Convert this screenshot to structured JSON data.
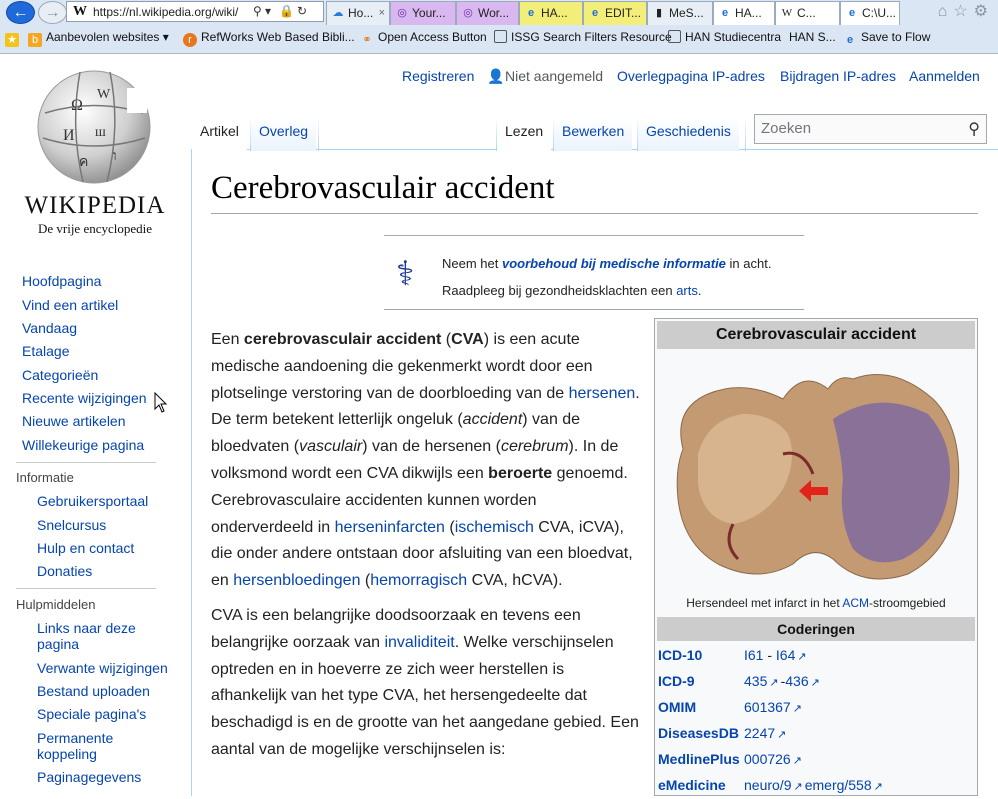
{
  "browser": {
    "url": "https://nl.wikipedia.org/wiki/",
    "tabs": [
      {
        "label": "Ho...",
        "icon": "cloud-icon",
        "bg": "#e8eef6"
      },
      {
        "label": "Your...",
        "icon": "circle-icon",
        "bg": "#d8b8ef"
      },
      {
        "label": "Wor...",
        "icon": "circle-icon",
        "bg": "#d8b8ef"
      },
      {
        "label": "HA...",
        "icon": "ie-icon",
        "bg": "#f3ee7a"
      },
      {
        "label": "EDIT...",
        "icon": "ie-icon",
        "bg": "#f3ee7a"
      },
      {
        "label": "MeS...",
        "icon": "mesh-icon",
        "bg": "#e8eef6"
      },
      {
        "label": "HA...",
        "icon": "ie-icon",
        "bg": "#ffffff"
      },
      {
        "label": "C...",
        "icon": "wikipedia-w-icon",
        "bg": "#ffffff"
      },
      {
        "label": "C:\\U...",
        "icon": "ie-icon",
        "bg": "#ffffff"
      }
    ],
    "favorites": [
      {
        "label": "Aanbevolen websites",
        "icon": "bing-icon"
      },
      {
        "label": "RefWorks Web Based Bibli...",
        "icon": "refworks-icon"
      },
      {
        "label": "Open Access Button",
        "icon": "openaccess-icon"
      },
      {
        "label": "ISSG Search Filters Resource",
        "icon": "page-icon"
      },
      {
        "label": "HAN Studiecentra",
        "icon": "page-icon"
      },
      {
        "label": "HAN S...",
        "icon": ""
      },
      {
        "label": "Save to Flow",
        "icon": "ie-icon"
      }
    ]
  },
  "wiki": {
    "logo_wordmark": "WIKIPEDIA",
    "logo_tagline": "De vrije encyclopedie",
    "personal": {
      "register": "Registreren",
      "not_logged_in": "Niet aangemeld",
      "talk_ip": "Overlegpagina IP-adres",
      "contrib_ip": "Bijdragen IP-adres",
      "login": "Aanmelden"
    },
    "tabs": {
      "article": "Artikel",
      "talk": "Overleg",
      "read": "Lezen",
      "edit": "Bewerken",
      "history": "Geschiedenis"
    },
    "search_placeholder": "Zoeken",
    "sidebar": {
      "main": [
        "Hoofdpagina",
        "Vind een artikel",
        "Vandaag",
        "Etalage",
        "Categorieën",
        "Recente wijzigingen",
        "Nieuwe artikelen",
        "Willekeurige pagina"
      ],
      "info_heading": "Informatie",
      "info": [
        "Gebruikersportaal",
        "Snelcursus",
        "Hulp en contact",
        "Donaties"
      ],
      "tools_heading": "Hulpmiddelen",
      "tools": [
        "Links naar deze pagina",
        "Verwante wijzigingen",
        "Bestand uploaden",
        "Speciale pagina's",
        "Permanente koppeling",
        "Paginagegevens"
      ]
    },
    "title": "Cerebrovasculair accident",
    "notice": {
      "l1_pre": "Neem het ",
      "l1_link": "voorbehoud bij medische informatie",
      "l1_post": " in acht.",
      "l2_pre": "Raadpleeg bij gezondheidsklachten een ",
      "l2_link": "arts",
      "l2_post": "."
    },
    "p1": {
      "a": "Een ",
      "b": "cerebrovasculair accident",
      "c": " (",
      "d": "CVA",
      "e": ") is een acute medische aandoening die gekenmerkt wordt door een plotselinge verstoring van de doorbloeding van de ",
      "f": "hersenen",
      "g": ". De term betekent letterlijk ongeluk (",
      "h": "accident",
      "i": ") van de bloedvaten (",
      "j": "vasculair",
      "k": ") van de hersenen (",
      "l": "cerebrum",
      "m": "). In de volksmond wordt een CVA dikwijls een ",
      "n": "beroerte",
      "o": " genoemd. Cerebrovasculaire accidenten kunnen worden onderverdeeld in ",
      "p": "herseninfarcten",
      "q": " (",
      "r": "ischemisch",
      "s": " CVA, iCVA), die onder andere ontstaan door afsluiting van een bloedvat, en ",
      "t": "hersenbloedingen",
      "u": " (",
      "v": "hemorragisch",
      "w": " CVA, hCVA)."
    },
    "p2": {
      "a": "CVA is een belangrijke doodsoorzaak en tevens een belangrijke oorzaak van ",
      "b": "invaliditeit",
      "c": ". Welke verschijnselen optreden en in hoeverre ze zich weer herstellen is afhankelijk van het type CVA, het hersengedeelte dat beschadigd is en de grootte van het aangedane gebied. Een aantal van de mogelijke verschijnselen is:"
    },
    "infobox": {
      "title": "Cerebrovasculair accident",
      "caption_pre": "Hersendeel met infarct in het ",
      "caption_link": "ACM",
      "caption_post": "-stroomgebied",
      "codes_heading": "Coderingen",
      "rows": [
        {
          "key": "ICD-10",
          "v1": "I61",
          "sep": " - ",
          "v2": "I64"
        },
        {
          "key": "ICD-9",
          "v1": "435",
          "sep": "-",
          "v2": "436"
        },
        {
          "key": "OMIM",
          "v1": "601367",
          "sep": "",
          "v2": ""
        },
        {
          "key": "DiseasesDB",
          "v1": "2247",
          "sep": "",
          "v2": ""
        },
        {
          "key": "MedlinePlus",
          "v1": "000726",
          "sep": "",
          "v2": ""
        },
        {
          "key": "eMedicine",
          "v1": "neuro/9",
          "sep": "",
          "v2": "emerg/558"
        }
      ]
    }
  }
}
